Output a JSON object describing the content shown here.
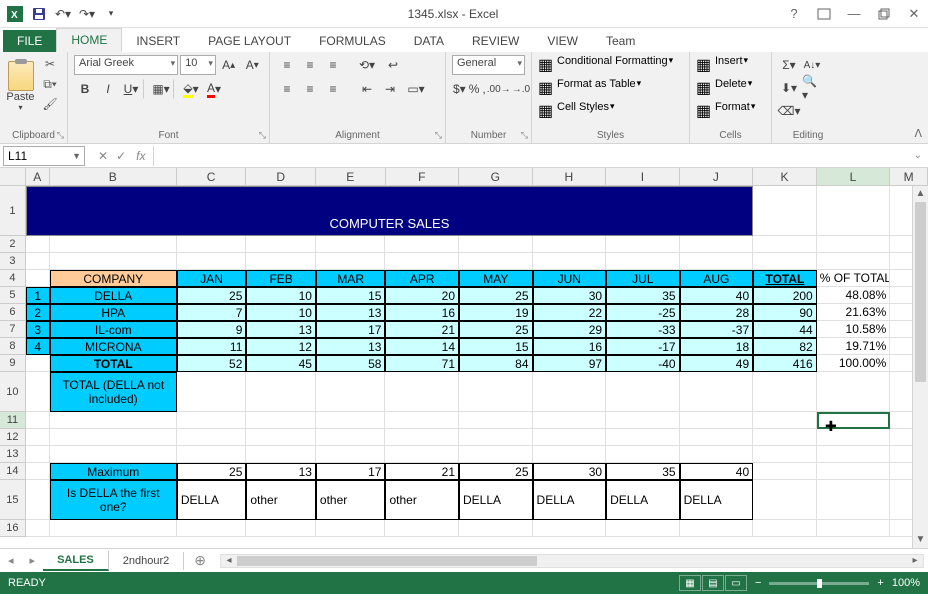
{
  "title": "1345.xlsx - Excel",
  "tabs": {
    "file": "FILE",
    "home": "HOME",
    "insert": "INSERT",
    "page": "PAGE LAYOUT",
    "formulas": "FORMULAS",
    "data": "DATA",
    "review": "REVIEW",
    "view": "VIEW",
    "team": "Team"
  },
  "groups": {
    "clipboard": "Clipboard",
    "font": "Font",
    "alignment": "Alignment",
    "number": "Number",
    "styles": "Styles",
    "cells": "Cells",
    "editing": "Editing"
  },
  "clipboard": {
    "paste": "Paste"
  },
  "font": {
    "name": "Arial Greek",
    "size": "10"
  },
  "number": {
    "format": "General"
  },
  "styles": {
    "cond": "Conditional Formatting",
    "table": "Format as Table",
    "cell": "Cell Styles"
  },
  "cells": {
    "insert": "Insert",
    "delete": "Delete",
    "format": "Format"
  },
  "namebox": "L11",
  "chart_data": {
    "type": "table",
    "title": "COMPUTER SALES",
    "columns": [
      "COMPANY",
      "JAN",
      "FEB",
      "MAR",
      "APR",
      "MAY",
      "JUN",
      "JUL",
      "AUG",
      "TOTAL",
      "% OF TOTAL"
    ],
    "rows": [
      {
        "idx": "1",
        "company": "DELLA",
        "vals": [
          "25",
          "10",
          "15",
          "20",
          "25",
          "30",
          "35",
          "40"
        ],
        "total": "200",
        "pct": "48.08%"
      },
      {
        "idx": "2",
        "company": "HPA",
        "vals": [
          "7",
          "10",
          "13",
          "16",
          "19",
          "22",
          "-25",
          "28"
        ],
        "total": "90",
        "pct": "21.63%"
      },
      {
        "idx": "3",
        "company": "IL-com",
        "vals": [
          "9",
          "13",
          "17",
          "21",
          "25",
          "29",
          "-33",
          "-37"
        ],
        "total": "44",
        "pct": "10.58%"
      },
      {
        "idx": "4",
        "company": "MICRONA",
        "vals": [
          "11",
          "12",
          "13",
          "14",
          "15",
          "16",
          "-17",
          "18"
        ],
        "total": "82",
        "pct": "19.71%"
      }
    ],
    "total_row": {
      "label": "TOTAL",
      "vals": [
        "52",
        "45",
        "58",
        "71",
        "84",
        "97",
        "-40",
        "49"
      ],
      "total": "416",
      "pct": "100.00%"
    },
    "note": "TOTAL   (DELLA not included)",
    "max_row": {
      "label": "Maximum",
      "vals": [
        "25",
        "13",
        "17",
        "21",
        "25",
        "30",
        "35",
        "40"
      ]
    },
    "first_row": {
      "label": "Is DELLA the first one?",
      "vals": [
        "DELLA",
        "other",
        "other",
        "other",
        "DELLA",
        "DELLA",
        "DELLA",
        "DELLA"
      ]
    }
  },
  "sheets": {
    "active": "SALES",
    "other": "2ndhour2"
  },
  "status": {
    "ready": "READY",
    "zoom": "100%"
  },
  "colw": {
    "A": 24,
    "B": 128,
    "C": 70,
    "D": 70,
    "E": 70,
    "F": 74,
    "G": 74,
    "H": 74,
    "I": 74,
    "J": 74,
    "K": 64,
    "L": 74,
    "M": 38
  }
}
